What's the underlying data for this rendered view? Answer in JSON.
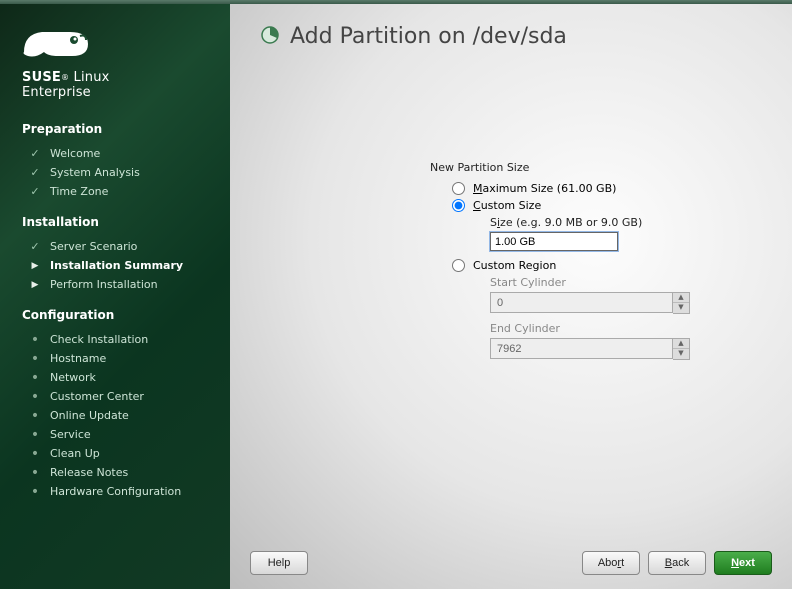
{
  "brand": {
    "line1": "SUSE",
    "line1suffix": " Linux",
    "line2": "Enterprise"
  },
  "sidebar": {
    "sections": [
      {
        "title": "Preparation",
        "items": [
          {
            "label": "Welcome",
            "state": "done"
          },
          {
            "label": "System Analysis",
            "state": "done"
          },
          {
            "label": "Time Zone",
            "state": "done"
          }
        ]
      },
      {
        "title": "Installation",
        "items": [
          {
            "label": "Server Scenario",
            "state": "done"
          },
          {
            "label": "Installation Summary",
            "state": "current"
          },
          {
            "label": "Perform Installation",
            "state": "pending-arrow"
          }
        ]
      },
      {
        "title": "Configuration",
        "items": [
          {
            "label": "Check Installation",
            "state": "pending"
          },
          {
            "label": "Hostname",
            "state": "pending"
          },
          {
            "label": "Network",
            "state": "pending"
          },
          {
            "label": "Customer Center",
            "state": "pending"
          },
          {
            "label": "Online Update",
            "state": "pending"
          },
          {
            "label": "Service",
            "state": "pending"
          },
          {
            "label": "Clean Up",
            "state": "pending"
          },
          {
            "label": "Release Notes",
            "state": "pending"
          },
          {
            "label": "Hardware Configuration",
            "state": "pending"
          }
        ]
      }
    ]
  },
  "page": {
    "title": "Add Partition on /dev/sda",
    "group": "New Partition Size",
    "maxsize": {
      "prefix": "M",
      "rest": "aximum Size (61.00 GB)",
      "selected": false
    },
    "customsize": {
      "prefix": "C",
      "rest": "ustom Size",
      "selected": true
    },
    "size_label_prefix": "S",
    "size_label_mid": "i",
    "size_label_rest": "ze (e.g. 9.0 MB or 9.0 GB)",
    "size_value": "1.00 GB",
    "customregion": {
      "label": "Custom Region",
      "selected": false
    },
    "start": {
      "label": "Start Cylinder",
      "value": "0"
    },
    "end": {
      "label": "End Cylinder",
      "value": "7962"
    }
  },
  "footer": {
    "help": "Help",
    "abort": {
      "pre": "Abo",
      "u": "r",
      "post": "t"
    },
    "back": {
      "u": "B",
      "post": "ack"
    },
    "next": {
      "u": "N",
      "post": "ext"
    }
  }
}
